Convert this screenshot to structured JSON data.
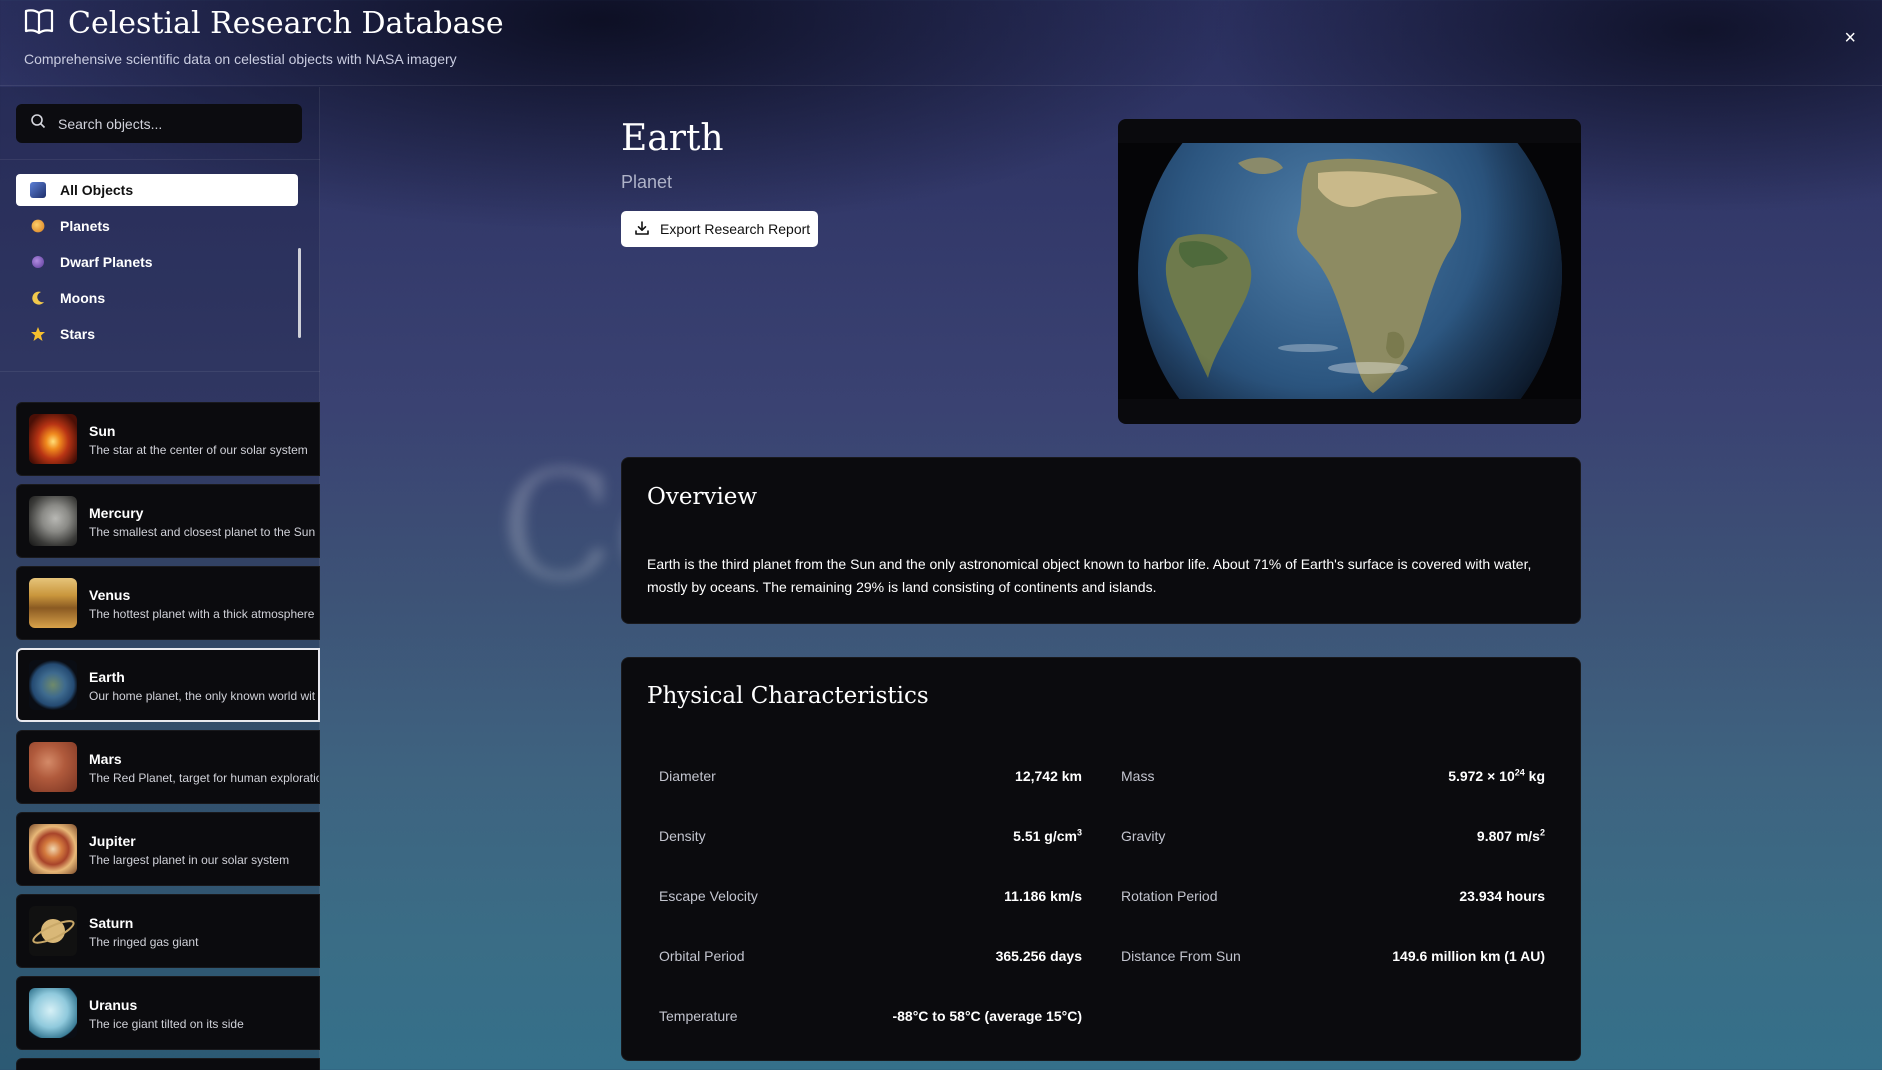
{
  "header": {
    "title": "Celestial Research Database",
    "subtitle": "Comprehensive scientific data on celestial objects with NASA imagery",
    "close_label": "×",
    "icon": "book-open-icon"
  },
  "sidebar": {
    "search": {
      "placeholder": "Search objects...",
      "value": "",
      "icon": "search-icon"
    },
    "categories": [
      {
        "label": "All Objects",
        "icon": "all-objects-icon",
        "active": true
      },
      {
        "label": "Planets",
        "icon": "planet-icon",
        "active": false
      },
      {
        "label": "Dwarf Planets",
        "icon": "dwarf-planet-icon",
        "active": false
      },
      {
        "label": "Moons",
        "icon": "moon-icon",
        "active": false
      },
      {
        "label": "Stars",
        "icon": "star-icon",
        "active": false
      }
    ],
    "objects": [
      {
        "name": "Sun",
        "desc": "The star at the center of our solar system",
        "color": "#d9531e"
      },
      {
        "name": "Mercury",
        "desc": "The smallest and closest planet to the Sun",
        "color": "#9a9a9a"
      },
      {
        "name": "Venus",
        "desc": "The hottest planet with a thick atmosphere",
        "color": "#d8a24a"
      },
      {
        "name": "Earth",
        "desc": "Our home planet, the only known world wit",
        "color": "#2f5d8a",
        "active": true
      },
      {
        "name": "Mars",
        "desc": "The Red Planet, target for human exploratio",
        "color": "#b05a3c"
      },
      {
        "name": "Jupiter",
        "desc": "The largest planet in our solar system",
        "color": "#c0703e"
      },
      {
        "name": "Saturn",
        "desc": "The ringed gas giant",
        "color": "#d4b37a"
      },
      {
        "name": "Uranus",
        "desc": "The ice giant tilted on its side",
        "color": "#8fc9dc"
      }
    ]
  },
  "main": {
    "name": "Earth",
    "type": "Planet",
    "export_label": "Export Research Report",
    "overview": {
      "heading": "Overview",
      "text": "Earth is the third planet from the Sun and the only astronomical object known to harbor life. About 71% of Earth's surface is covered with water, mostly by oceans. The remaining 29% is land consisting of continents and islands."
    },
    "physical": {
      "heading": "Physical Characteristics",
      "diameter_label": "Diameter",
      "diameter": "12,742 km",
      "mass_label": "Mass",
      "mass_base": "5.972 × 10",
      "mass_exp": "24",
      "mass_unit": " kg",
      "density_label": "Density",
      "density_base": "5.51 g/cm",
      "density_exp": "3",
      "gravity_label": "Gravity",
      "gravity_base": "9.807 m/s",
      "gravity_exp": "2",
      "escape_label": "Escape Velocity",
      "escape": "11.186 km/s",
      "rotation_label": "Rotation Period",
      "rotation": "23.934 hours",
      "orbital_label": "Orbital Period",
      "orbital": "365.256 days",
      "distance_label": "Distance From Sun",
      "distance": "149.6 million km (1 AU)",
      "temp_label": "Temperature",
      "temp": "-88°C to 58°C (average 15°C)"
    }
  }
}
